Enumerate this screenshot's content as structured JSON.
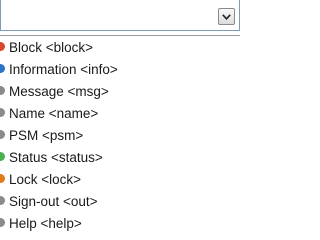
{
  "combo": {
    "value": "",
    "button_icon": "chevron-down-icon"
  },
  "dropdown": {
    "items": [
      {
        "label": "Block <block>",
        "marker_color": "#d9482a"
      },
      {
        "label": "Information <info>",
        "marker_color": "#2a73c9"
      },
      {
        "label": "Message <msg>",
        "marker_color": "#8a8a8a"
      },
      {
        "label": "Name <name>",
        "marker_color": "#8a8a8a"
      },
      {
        "label": "PSM <psm>",
        "marker_color": "#8a8a8a"
      },
      {
        "label": "Status <status>",
        "marker_color": "#4caf50"
      },
      {
        "label": "Lock <lock>",
        "marker_color": "#e07b1a"
      },
      {
        "label": "Sign-out <out>",
        "marker_color": "#8a8a8a"
      },
      {
        "label": "Help <help>",
        "marker_color": "#8a8a8a"
      }
    ]
  }
}
